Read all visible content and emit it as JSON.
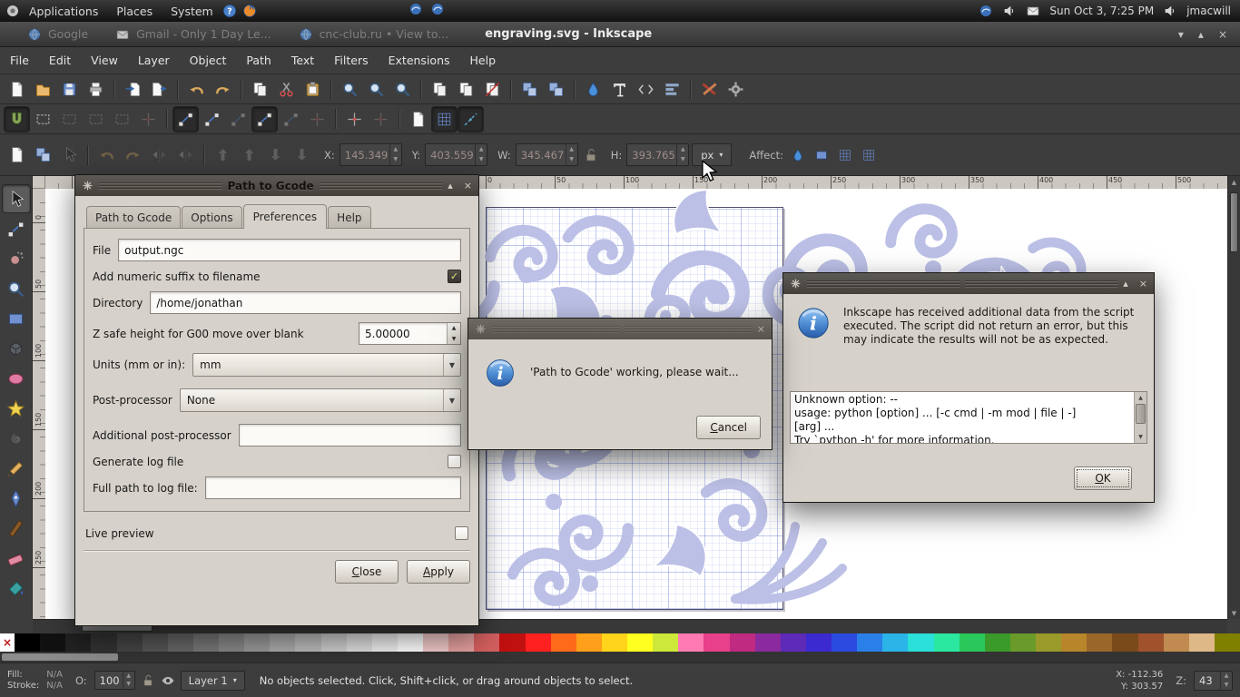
{
  "panel": {
    "menus": [
      "Applications",
      "Places",
      "System"
    ],
    "clock": "Sun Oct 3, 7:25 PM",
    "user": "jmacwill"
  },
  "titlebar": {
    "background_windows": [
      {
        "icon": "globe-icon",
        "label": "Google"
      },
      {
        "icon": "mail-icon",
        "label": "Gmail - Only 1 Day Le..."
      },
      {
        "icon": "globe-icon",
        "label": "cnc-club.ru • View to..."
      }
    ],
    "active_title": "engraving.svg - Inkscape",
    "controls": {
      "shade": "▾",
      "maximize": "▴",
      "close": "×"
    }
  },
  "menubar": {
    "items": [
      "File",
      "Edit",
      "View",
      "Layer",
      "Object",
      "Path",
      "Text",
      "Filters",
      "Extensions",
      "Help"
    ]
  },
  "toolbars": {
    "commands": [
      {
        "name": "new-document-button",
        "icon": "doc"
      },
      {
        "name": "open-document-button",
        "icon": "folder"
      },
      {
        "name": "save-document-button",
        "icon": "save"
      },
      {
        "name": "print-button",
        "icon": "print"
      },
      {
        "divider": true
      },
      {
        "name": "import-button",
        "icon": "import"
      },
      {
        "name": "export-button",
        "icon": "export"
      },
      {
        "divider": true
      },
      {
        "name": "undo-button",
        "icon": "undo"
      },
      {
        "name": "redo-button",
        "icon": "redo"
      },
      {
        "divider": true
      },
      {
        "name": "copy-button",
        "icon": "copy"
      },
      {
        "name": "cut-button",
        "icon": "cut"
      },
      {
        "name": "paste-button",
        "icon": "paste"
      },
      {
        "divider": true
      },
      {
        "name": "zoom-selection-button",
        "icon": "zoom"
      },
      {
        "name": "zoom-drawing-button",
        "icon": "zoom"
      },
      {
        "name": "zoom-page-button",
        "icon": "zoom"
      },
      {
        "divider": true
      },
      {
        "name": "duplicate-button",
        "icon": "copy"
      },
      {
        "name": "create-clone-button",
        "icon": "copy"
      },
      {
        "name": "unlink-clone-button",
        "icon": "unlink"
      },
      {
        "divider": true
      },
      {
        "name": "group-button",
        "icon": "group"
      },
      {
        "name": "ungroup-button",
        "icon": "group"
      },
      {
        "divider": true
      },
      {
        "name": "fill-stroke-dialog-button",
        "icon": "fillstroke"
      },
      {
        "name": "text-dialog-button",
        "icon": "text"
      },
      {
        "name": "xml-editor-button",
        "icon": "xml"
      },
      {
        "name": "align-dialog-button",
        "icon": "align"
      },
      {
        "divider": true
      },
      {
        "name": "tools-button",
        "icon": "wrench"
      },
      {
        "name": "preferences-button",
        "icon": "gear"
      }
    ],
    "snap": [
      {
        "name": "snap-enable-toggle",
        "icon": "snapmag",
        "pressed": true
      },
      {
        "name": "snap-bbox-toggle",
        "icon": "bbox"
      },
      {
        "name": "snap-bbox-edges-toggle",
        "icon": "bbox",
        "dim": true
      },
      {
        "name": "snap-bbox-corners-toggle",
        "icon": "bbox",
        "dim": true
      },
      {
        "name": "snap-bbox-midpoints-toggle",
        "icon": "bbox",
        "dim": true
      },
      {
        "name": "snap-bbox-centers-toggle",
        "icon": "center",
        "dim": true
      },
      {
        "divider": true
      },
      {
        "name": "snap-nodes-toggle",
        "icon": "node",
        "pressed": true
      },
      {
        "name": "snap-paths-toggle",
        "icon": "node"
      },
      {
        "name": "snap-path-intersections-toggle",
        "icon": "node",
        "dim": true
      },
      {
        "name": "snap-cusp-nodes-toggle",
        "icon": "node",
        "pressed": true
      },
      {
        "name": "snap-smooth-nodes-toggle",
        "icon": "node",
        "dim": true
      },
      {
        "name": "snap-midpoints-toggle",
        "icon": "center",
        "dim": true
      },
      {
        "divider": true
      },
      {
        "name": "snap-object-centers-toggle",
        "icon": "center"
      },
      {
        "name": "snap-rotation-centers-toggle",
        "icon": "center",
        "dim": true
      },
      {
        "divider": true
      },
      {
        "name": "snap-page-border-toggle",
        "icon": "doc"
      },
      {
        "name": "snap-grid-toggle",
        "icon": "gridsym",
        "pressed": true
      },
      {
        "name": "snap-guides-toggle",
        "icon": "guidesym",
        "pressed": true
      }
    ],
    "select_options": [
      {
        "name": "select-all-button",
        "icon": "doc"
      },
      {
        "name": "select-all-layers-button",
        "icon": "group"
      },
      {
        "name": "deselect-button",
        "icon": "cursor",
        "dim": true
      },
      {
        "divider": true
      },
      {
        "name": "rotate-ccw-button",
        "icon": "undo",
        "dim": true
      },
      {
        "name": "rotate-cw-button",
        "icon": "redo",
        "dim": true
      },
      {
        "name": "flip-horizontal-button",
        "icon": "fliph",
        "dim": true
      },
      {
        "name": "flip-vertical-button",
        "icon": "fliph",
        "dim": true
      },
      {
        "divider": true
      },
      {
        "name": "raise-to-top-button",
        "icon": "raise",
        "dim": true
      },
      {
        "name": "raise-button",
        "icon": "raise",
        "dim": true
      },
      {
        "name": "lower-button",
        "icon": "lower",
        "dim": true
      },
      {
        "name": "lower-to-bottom-button",
        "icon": "lower",
        "dim": true
      }
    ],
    "affect": [
      {
        "name": "scale-stroke-toggle",
        "icon": "fillstroke"
      },
      {
        "name": "scale-corners-toggle",
        "icon": "recttool"
      },
      {
        "name": "transform-gradients-toggle",
        "icon": "gridsym"
      },
      {
        "name": "transform-patterns-toggle",
        "icon": "gridsym"
      }
    ],
    "fields": {
      "x_label": "X:",
      "x_value": "145.349",
      "y_label": "Y:",
      "y_value": "403.559",
      "w_label": "W:",
      "w_value": "345.467",
      "h_label": "H:",
      "h_value": "393.765",
      "units": "px",
      "affect_label": "Affect:"
    }
  },
  "toolbox": {
    "tools": [
      {
        "name": "tool-selector",
        "icon": "cursor",
        "pressed": true
      },
      {
        "name": "tool-node-editor",
        "icon": "node"
      },
      {
        "name": "tool-tweak",
        "icon": "tweak"
      },
      {
        "name": "tool-zoom",
        "icon": "zoom"
      },
      {
        "name": "tool-rectangle",
        "icon": "recttool"
      },
      {
        "name": "tool-3dbox",
        "icon": "cube"
      },
      {
        "name": "tool-ellipse",
        "icon": "ellipsetool"
      },
      {
        "name": "tool-star",
        "icon": "star"
      },
      {
        "name": "tool-spiral",
        "icon": "spiral"
      },
      {
        "name": "tool-pencil",
        "icon": "pencil"
      },
      {
        "name": "tool-pen",
        "icon": "pen"
      },
      {
        "name": "tool-calligraphy",
        "icon": "callig"
      },
      {
        "name": "tool-eraser",
        "icon": "eraser"
      },
      {
        "name": "tool-paint-bucket",
        "icon": "bucket"
      }
    ]
  },
  "ruler": {
    "h_labels": [
      "0",
      "50",
      "100",
      "150",
      "200",
      "250",
      "300",
      "350",
      "400",
      "450",
      "500"
    ],
    "v_labels": [
      "0",
      "50",
      "100",
      "150",
      "200",
      "250"
    ]
  },
  "gcode_dialog": {
    "title": "Path to Gcode",
    "tabs": [
      "Path to Gcode",
      "Options",
      "Preferences",
      "Help"
    ],
    "active_tab": "Preferences",
    "file_label": "File",
    "file_value": "output.ngc",
    "suffix_label": "Add numeric suffix to filename",
    "suffix_checked": true,
    "directory_label": "Directory",
    "directory_value": "/home/jonathan",
    "zsafe_label": "Z safe height for G00 move over blank",
    "zsafe_value": "5.00000",
    "units_label": "Units (mm or in):",
    "units_value": "mm",
    "postprocessor_label": "Post-processor",
    "postprocessor_value": "None",
    "additional_label": "Additional post-processor",
    "additional_value": "",
    "generate_log_label": "Generate log file",
    "generate_log_checked": false,
    "log_path_label": "Full path to log file:",
    "log_path_value": "",
    "live_preview_label": "Live preview",
    "live_preview_checked": false,
    "close_button": "Close",
    "apply_button": "Apply"
  },
  "working_dialog": {
    "message": "'Path to Gcode' working, please wait...",
    "cancel_button": "Cancel"
  },
  "error_dialog": {
    "message": "Inkscape has received additional data from the script executed.  The script did not return an error, but this may indicate the results will not be as expected.",
    "output_lines": [
      "Unknown option: --",
      "usage: python [option] ... [-c cmd | -m mod | file | -]",
      "[arg] ...",
      "Try `python -h' for more information."
    ],
    "ok_button": "OK"
  },
  "statusbar": {
    "fill_label": "Fill:",
    "fill_value": "N/A",
    "stroke_label": "Stroke:",
    "stroke_value": "N/A",
    "opacity_label": "O:",
    "opacity_value": "100",
    "layer_value": "Layer 1",
    "message": "No objects selected. Click, Shift+click, or drag around objects to select.",
    "x_label": "X:",
    "x_value": "-112.36",
    "y_label": "Y:",
    "y_value": "303.57",
    "zoom_label": "Z:",
    "zoom_value": "43"
  },
  "palette": {
    "none_glyph": "×",
    "colors": [
      "#000000",
      "#111111",
      "#222222",
      "#333333",
      "#444444",
      "#555555",
      "#666666",
      "#777777",
      "#888888",
      "#999999",
      "#aaaaaa",
      "#bbbbbb",
      "#cccccc",
      "#dddddd",
      "#eeeeee",
      "#ffffff",
      "#f2c9c9",
      "#e39e9e",
      "#d35f5f",
      "#c01010",
      "#ff2020",
      "#ff6a1a",
      "#ff9f1a",
      "#ffd41a",
      "#ffff20",
      "#cde838",
      "#ff7ab2",
      "#e8408a",
      "#c02a80",
      "#8a2a9e",
      "#5e2ab8",
      "#3a2ad0",
      "#2a4ae0",
      "#2a80e8",
      "#2ab4e8",
      "#2ae0d8",
      "#2ae8a0",
      "#2ac85a",
      "#3a9a2a",
      "#6a9a2a",
      "#9a9a2a",
      "#b8862a",
      "#9a662a",
      "#7a4a1a",
      "#a0522d",
      "#c08a50",
      "#deb887",
      "#808000"
    ]
  }
}
